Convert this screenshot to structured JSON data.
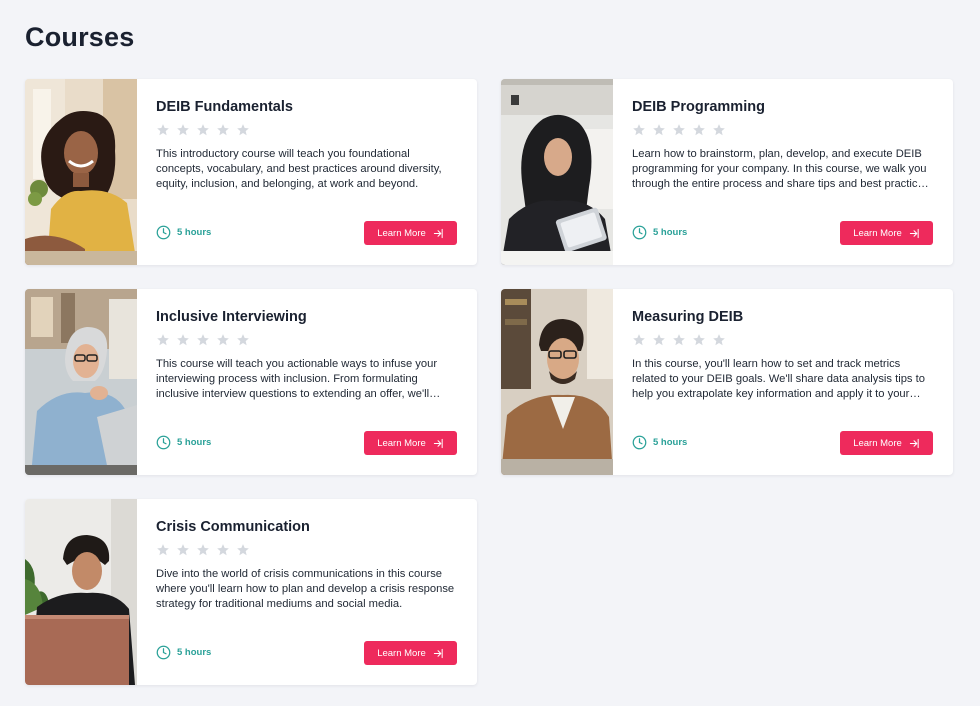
{
  "page": {
    "title": "Courses"
  },
  "colors": {
    "accent": "#ee2a5c",
    "duration": "#2aa198",
    "star": "#d4d8de",
    "background": "#f3f4f8"
  },
  "icons": {
    "star": "star-icon",
    "clock": "clock-icon",
    "arrow": "sign-in-arrow-icon"
  },
  "courses": [
    {
      "title": "DEIB Fundamentals",
      "rating": 0,
      "description": "This introductory course will teach you foundational concepts, vocabulary, and best practices around diversity, equity, inclusion, and belonging, at work and beyond.",
      "duration": "5 hours",
      "button": "Learn More"
    },
    {
      "title": "DEIB Programming",
      "rating": 0,
      "description": "Learn how to brainstorm, plan, develop, and execute DEIB programming for your company. In this course, we walk you through the entire process and share tips and best practices along the way.",
      "duration": "5 hours",
      "button": "Learn More"
    },
    {
      "title": "Inclusive Interviewing",
      "rating": 0,
      "description": "This course will teach you actionable ways to infuse your interviewing process with inclusion. From formulating inclusive interview questions to extending an offer, we'll cover it all.",
      "duration": "5 hours",
      "button": "Learn More"
    },
    {
      "title": "Measuring DEIB",
      "rating": 0,
      "description": "In this course, you'll learn how to set and track metrics related to your DEIB goals. We'll share data analysis tips to help you extrapolate key information and apply it to your strategy.",
      "duration": "5 hours",
      "button": "Learn More"
    },
    {
      "title": "Crisis Communication",
      "rating": 0,
      "description": "Dive into the world of crisis communications in this course where you'll learn how to plan and develop a crisis response strategy for traditional mediums and social media.",
      "duration": "5 hours",
      "button": "Learn More"
    }
  ]
}
